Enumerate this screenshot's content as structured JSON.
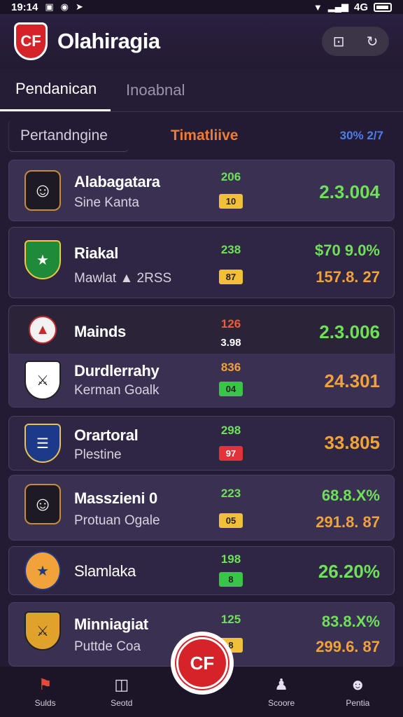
{
  "status_bar": {
    "time": "19:14",
    "battery": "4G"
  },
  "app": {
    "title": "Olahiragia",
    "logo_text": "CF",
    "fab_text": "CF"
  },
  "tabs": [
    {
      "label": "Pendanican"
    },
    {
      "label": "Inoabnal"
    }
  ],
  "filter": {
    "selected": "Pertandngine",
    "live_label": "Timatliive",
    "percent": "30% 2/7"
  },
  "matches": [
    {
      "name": "Alabagatara",
      "sub": "Sine Kanta",
      "stat": "206",
      "pill": "10",
      "pill_color": "yellow",
      "odds": "2.3.004",
      "odds2": ""
    },
    {
      "name": "Riakal",
      "sub": "Mawlat ▲ 2RSS",
      "stat": "238",
      "pill": "87",
      "pill_color": "yellow",
      "odds": "$70 9.0%",
      "odds2": "157.8. 27"
    },
    {
      "name": "Mainds",
      "sub": "",
      "stat": "126",
      "stat2": "3.98",
      "odds": "2.3.006"
    },
    {
      "name": "Durdlerrahy",
      "sub": "Kerman Goalk",
      "stat": "836",
      "pill": "04",
      "pill_color": "green",
      "odds": "24.301"
    },
    {
      "name": "Orartoral",
      "sub": "Plestine",
      "stat": "298",
      "pill": "97",
      "pill_color": "red",
      "odds": "33.805"
    },
    {
      "name": "Masszieni 0",
      "sub": "Protuan Ogale",
      "stat": "223",
      "pill": "05",
      "pill_color": "yellow",
      "odds": "68.8.X%",
      "odds2": "291.8. 87"
    },
    {
      "name": "Slamlaka",
      "sub": "",
      "stat": "198",
      "pill": "8",
      "pill_color": "green",
      "odds": "26.20%"
    },
    {
      "name": "Minniagiat",
      "sub": "Puttde Coa",
      "stat": "125",
      "pill": "8",
      "pill_color": "yellow",
      "odds": "83.8.X%",
      "odds2": "299.6. 87"
    }
  ],
  "nav": [
    {
      "label": "Sulds",
      "icon": "shield-flag-icon"
    },
    {
      "label": "Seotd",
      "icon": "device-icon"
    },
    {
      "label": "Scoore",
      "icon": "trophy-icon"
    },
    {
      "label": "Pentia",
      "icon": "profile-icon"
    }
  ]
}
